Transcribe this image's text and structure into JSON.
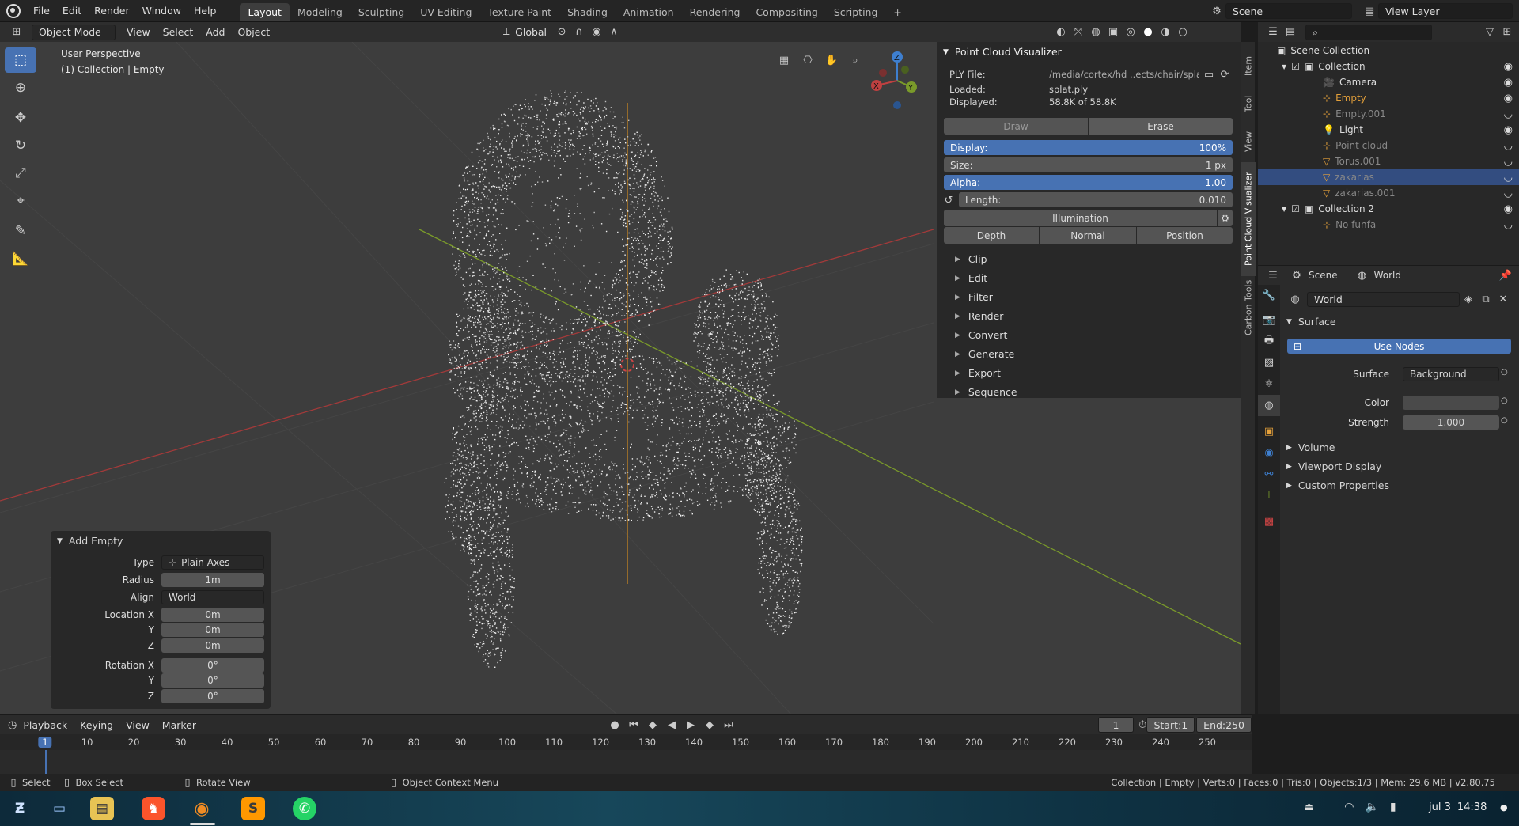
{
  "menubar": {
    "items": [
      "File",
      "Edit",
      "Render",
      "Window",
      "Help"
    ],
    "workspaces": [
      "Layout",
      "Modeling",
      "Sculpting",
      "UV Editing",
      "Texture Paint",
      "Shading",
      "Animation",
      "Rendering",
      "Compositing",
      "Scripting"
    ],
    "active_workspace": "Layout",
    "scene_field": "Scene",
    "view_layer_field": "View Layer",
    "add_tab": "+"
  },
  "viewport_header": {
    "mode": "Object Mode",
    "menus": [
      "View",
      "Select",
      "Add",
      "Object"
    ],
    "transform_orientation": "Global"
  },
  "viewport": {
    "perspective_label": "User Perspective",
    "collection_label": "(1) Collection | Empty",
    "gizmo_axes": [
      "X",
      "Y",
      "Z"
    ]
  },
  "pcv_panel": {
    "title": "Point Cloud Visualizer",
    "ply_label": "PLY File:",
    "ply_path": "/media/cortex/hd ..ects/chair/splat.ply",
    "loaded_label": "Loaded:",
    "loaded_value": "splat.ply",
    "displayed_label": "Displayed:",
    "displayed_value": "58.8K of 58.8K",
    "draw_label": "Draw",
    "erase_label": "Erase",
    "display_label": "Display:",
    "display_value": "100%",
    "size_label": "Size:",
    "size_value": "1 px",
    "alpha_label": "Alpha:",
    "alpha_value": "1.00",
    "length_label": "Length:",
    "length_value": "0.010",
    "illumination_label": "Illumination",
    "shading_buttons": [
      "Depth",
      "Normal",
      "Position"
    ],
    "subpanels": [
      "Clip",
      "Edit",
      "Filter",
      "Render",
      "Convert",
      "Generate",
      "Export",
      "Sequence"
    ]
  },
  "sidebar_tabs": [
    "Item",
    "Tool",
    "View",
    "Point Cloud Visualizer",
    "Carbon Tools"
  ],
  "outliner": {
    "root": "Scene Collection",
    "items": [
      {
        "name": "Collection",
        "indent": 1,
        "style": "normal"
      },
      {
        "name": "Camera",
        "indent": 2,
        "style": "normal"
      },
      {
        "name": "Empty",
        "indent": 2,
        "style": "orange"
      },
      {
        "name": "Empty.001",
        "indent": 2,
        "style": "dim"
      },
      {
        "name": "Light",
        "indent": 2,
        "style": "normal"
      },
      {
        "name": "Point cloud",
        "indent": 2,
        "style": "dim"
      },
      {
        "name": "Torus.001",
        "indent": 2,
        "style": "dim"
      },
      {
        "name": "zakarias",
        "indent": 2,
        "style": "dim"
      },
      {
        "name": "zakarias.001",
        "indent": 2,
        "style": "dim"
      },
      {
        "name": "Collection 2",
        "indent": 1,
        "style": "normal"
      },
      {
        "name": "No funfa",
        "indent": 2,
        "style": "dim"
      }
    ]
  },
  "properties": {
    "breadcrumb_scene": "Scene",
    "breadcrumb_world": "World",
    "world_name": "World",
    "surface_section": "Surface",
    "use_nodes_label": "Use Nodes",
    "surface_label": "Surface",
    "surface_value": "Background",
    "color_label": "Color",
    "strength_label": "Strength",
    "strength_value": "1.000",
    "collapsed_sections": [
      "Volume",
      "Viewport Display",
      "Custom Properties"
    ]
  },
  "add_empty": {
    "title": "Add Empty",
    "type_label": "Type",
    "type_value": "Plain Axes",
    "radius_label": "Radius",
    "radius_value": "1m",
    "align_label": "Align",
    "align_value": "World",
    "location_x_label": "Location X",
    "y_label": "Y",
    "z_label": "Z",
    "location_x": "0m",
    "location_y": "0m",
    "location_z": "0m",
    "rotation_x_label": "Rotation X",
    "rotation_x": "0°",
    "rotation_y": "0°",
    "rotation_z": "0°"
  },
  "timeline": {
    "menus": [
      "Playback",
      "Keying",
      "View",
      "Marker"
    ],
    "current_frame": "1",
    "start_label": "Start:",
    "start_value": "1",
    "end_label": "End:",
    "end_value": "250",
    "ruler_marks": [
      "1",
      "10",
      "20",
      "30",
      "40",
      "50",
      "60",
      "70",
      "80",
      "90",
      "100",
      "110",
      "120",
      "130",
      "140",
      "150",
      "160",
      "170",
      "180",
      "190",
      "200",
      "210",
      "220",
      "230",
      "240",
      "250"
    ]
  },
  "statusbar": {
    "select": "Select",
    "box_select": "Box Select",
    "rotate_view": "Rotate View",
    "context_menu": "Object Context Menu",
    "stats": "Collection | Empty | Verts:0 | Faces:0 | Tris:0 | Objects:1/3 | Mem: 29.6 MB | v2.80.75"
  },
  "taskbar": {
    "date": "jul 3",
    "time": "14:38"
  },
  "colors": {
    "accent_blue": "#4772b3",
    "x_axis": "#a33a3a",
    "y_axis": "#7a9a2a",
    "z_axis": "#3e7fcf",
    "active_object": "#e4a03a"
  }
}
